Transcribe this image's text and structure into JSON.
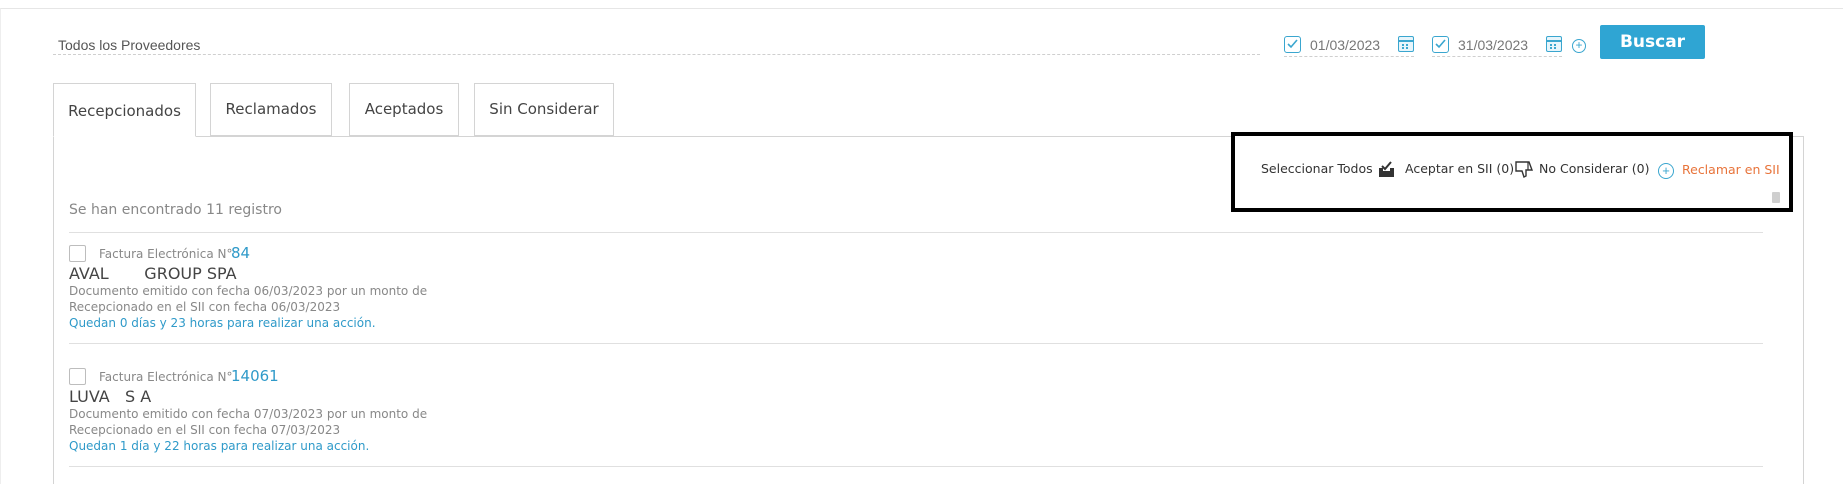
{
  "filters": {
    "provider": "Todos los Proveedores",
    "date_from": "01/03/2023",
    "date_to": "31/03/2023",
    "search_label": "Buscar"
  },
  "tabs": [
    {
      "label": "Recepcionados",
      "active": true
    },
    {
      "label": "Reclamados",
      "active": false
    },
    {
      "label": "Aceptados",
      "active": false
    },
    {
      "label": "Sin Considerar",
      "active": false
    }
  ],
  "actions": {
    "select_all": "Seleccionar Todos",
    "accept": "Aceptar en SII (0)",
    "not_consider": "No Considerar (0)",
    "claim": "Reclamar en SII"
  },
  "results_count": "Se han encontrado 11 registro",
  "documents": [
    {
      "type": "Factura Electrónica N°",
      "number": "84",
      "name": "AVAL       GROUP SPA",
      "emitted": "Documento emitido con fecha 06/03/2023 por un monto de",
      "received": "Recepcionado en el SII con fecha 06/03/2023",
      "remaining": "Quedan 0 días y 23 horas para realizar una acción."
    },
    {
      "type": "Factura Electrónica N°",
      "number": "14061",
      "name": "LUVA   S A",
      "emitted": "Documento emitido con fecha 07/03/2023 por un monto de",
      "received": "Recepcionado en el SII con fecha 07/03/2023",
      "remaining": "Quedan 1 día y 22 horas para realizar una acción."
    }
  ],
  "colors": {
    "accent": "#2fa5d3",
    "link": "#2f9ac9",
    "claim": "#e8743b"
  }
}
